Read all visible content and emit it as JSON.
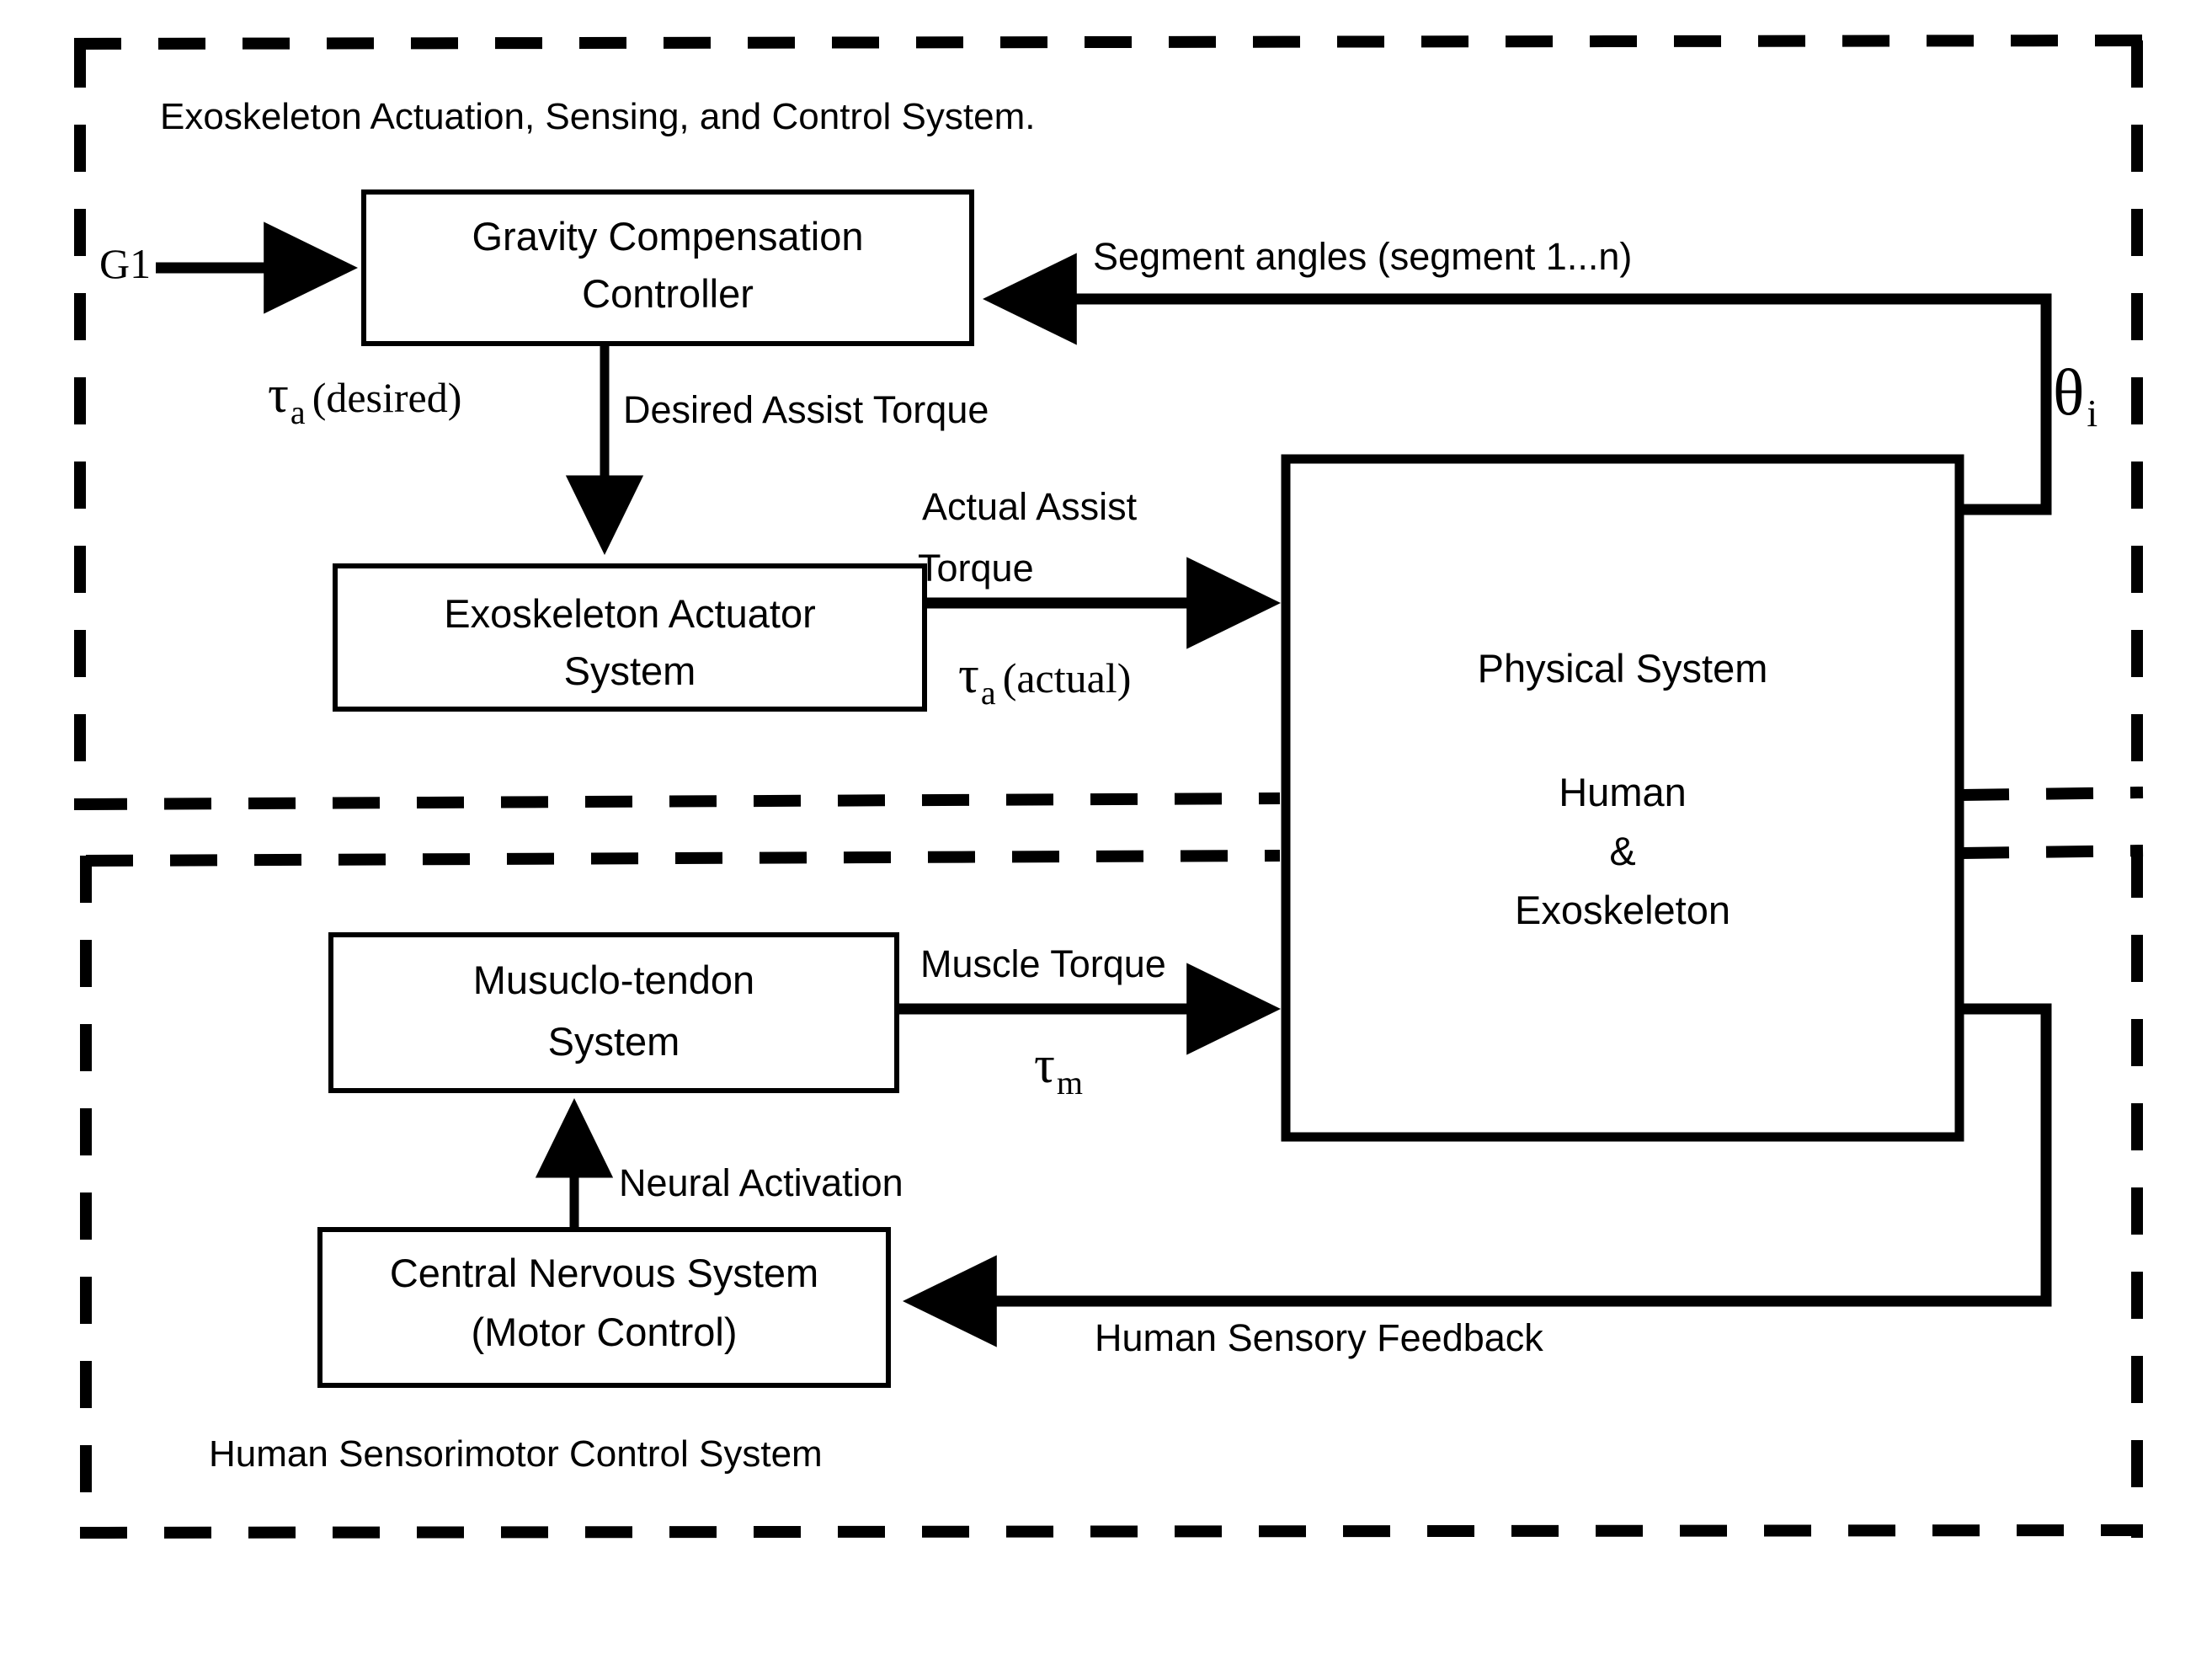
{
  "diagram": {
    "title_top_region": "Exoskeleton Actuation, Sensing, and Control System.",
    "title_bottom_region": "Human Sensorimotor Control System",
    "input_label": "G1",
    "boxes": {
      "gravity_controller": {
        "line1": "Gravity Compensation",
        "line2": "Controller"
      },
      "exo_actuator": {
        "line1": "Exoskeleton Actuator",
        "line2": "System"
      },
      "physical_system": {
        "line1": "Physical System",
        "line2": "Human",
        "line3": "&",
        "line4": "Exoskeleton"
      },
      "musculo_tendon": {
        "line1": "Musuclo-tendon",
        "line2": "System"
      },
      "cns": {
        "line1": "Central Nervous System",
        "line2": "(Motor Control)"
      }
    },
    "signals": {
      "segment_angles": "Segment angles (segment 1...n)",
      "desired_assist_torque": "Desired Assist Torque",
      "actual_assist_torque_l1": "Actual Assist",
      "actual_assist_torque_l2": "Torque",
      "muscle_torque": "Muscle Torque",
      "neural_activation": "Neural Activation",
      "human_sensory_feedback": "Human Sensory Feedback"
    },
    "symbols": {
      "tau_desired": {
        "base": "τ",
        "sub": "a",
        "qualifier": "(desired)"
      },
      "tau_actual": {
        "base": "τ",
        "sub": "a",
        "qualifier": "(actual)"
      },
      "tau_muscle": {
        "base": "τ",
        "sub": "m",
        "qualifier": ""
      },
      "theta_i": {
        "base": "θ",
        "sub": "i"
      }
    },
    "colors": {
      "stroke": "#000000",
      "background": "#ffffff"
    }
  }
}
